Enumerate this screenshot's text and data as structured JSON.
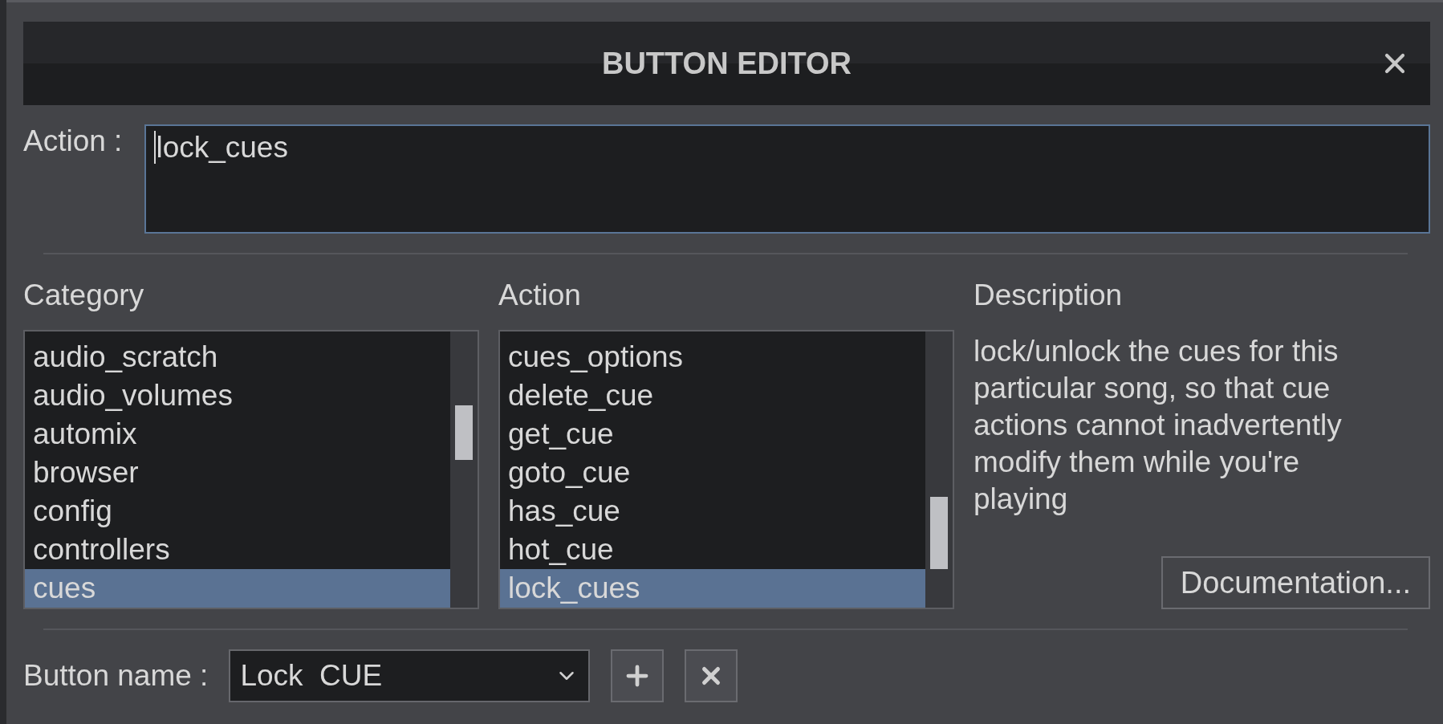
{
  "dialog": {
    "title": "BUTTON EDITOR"
  },
  "action_field": {
    "label": "Action :",
    "value": "lock_cues"
  },
  "category": {
    "heading": "Category",
    "items": [
      {
        "label": "audio_scratch",
        "selected": false
      },
      {
        "label": "audio_volumes",
        "selected": false
      },
      {
        "label": "automix",
        "selected": false
      },
      {
        "label": "browser",
        "selected": false
      },
      {
        "label": "config",
        "selected": false
      },
      {
        "label": "controllers",
        "selected": false
      },
      {
        "label": "cues",
        "selected": true
      }
    ]
  },
  "action": {
    "heading": "Action",
    "items": [
      {
        "label": "cues_options",
        "selected": false
      },
      {
        "label": "delete_cue",
        "selected": false
      },
      {
        "label": "get_cue",
        "selected": false
      },
      {
        "label": "goto_cue",
        "selected": false
      },
      {
        "label": "has_cue",
        "selected": false
      },
      {
        "label": "hot_cue",
        "selected": false
      },
      {
        "label": "lock_cues",
        "selected": true
      }
    ]
  },
  "description": {
    "heading": "Description",
    "text": "lock/unlock the cues for this particular song, so that cue actions cannot inadvertently modify them while you're playing",
    "button": "Documentation..."
  },
  "button_name": {
    "label": "Button name :",
    "value": "Lock  CUE"
  }
}
